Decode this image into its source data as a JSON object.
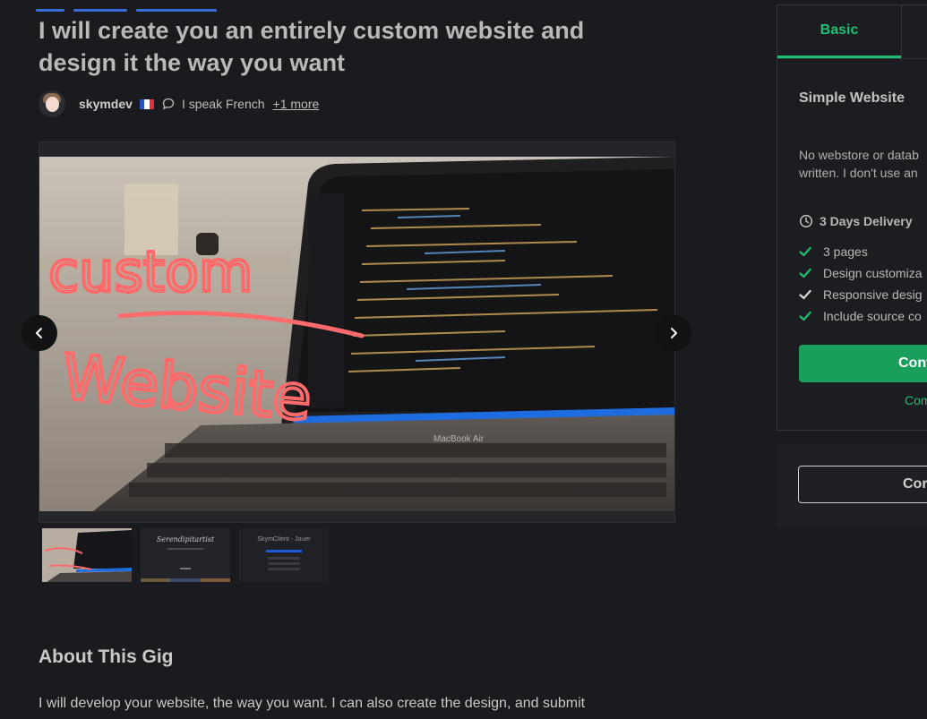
{
  "gig": {
    "title": "I will create you an entirely custom website and design it the way you want"
  },
  "seller": {
    "name": "skymdev",
    "flag": "flag-france-icon",
    "language_text": "I speak French",
    "more_languages": "+1 more"
  },
  "gallery": {
    "main_image": {
      "overlay_text_1": "custom",
      "overlay_text_2": "Website",
      "laptop_label": "MacBook Air"
    },
    "thumbnails": [
      {
        "name": "thumbnail-custom-website"
      },
      {
        "name": "thumbnail-serendipitartist",
        "caption": "Serendipitartist"
      },
      {
        "name": "thumbnail-skymclient",
        "caption": "SkymClient - Jouer"
      }
    ]
  },
  "about": {
    "heading": "About This Gig",
    "text": "I will develop your website, the way you want. I can also create the design, and submit"
  },
  "package": {
    "tab_label": "Basic",
    "title": "Simple Website",
    "description_line1": "No webstore or datab",
    "description_line2": "written. I don't use an",
    "delivery": "3 Days Delivery",
    "features": [
      {
        "label": "3 pages",
        "included": true
      },
      {
        "label": "Design customiza",
        "included": true
      },
      {
        "label": "Responsive desig",
        "included": false
      },
      {
        "label": "Include source co",
        "included": true
      }
    ],
    "continue_label": "Cont",
    "compare_label": "Com"
  },
  "contact": {
    "button_label": "Cor"
  },
  "colors": {
    "accent": "#1dbf73",
    "button_green": "#1a9e5b",
    "background": "#1a1b1e"
  }
}
